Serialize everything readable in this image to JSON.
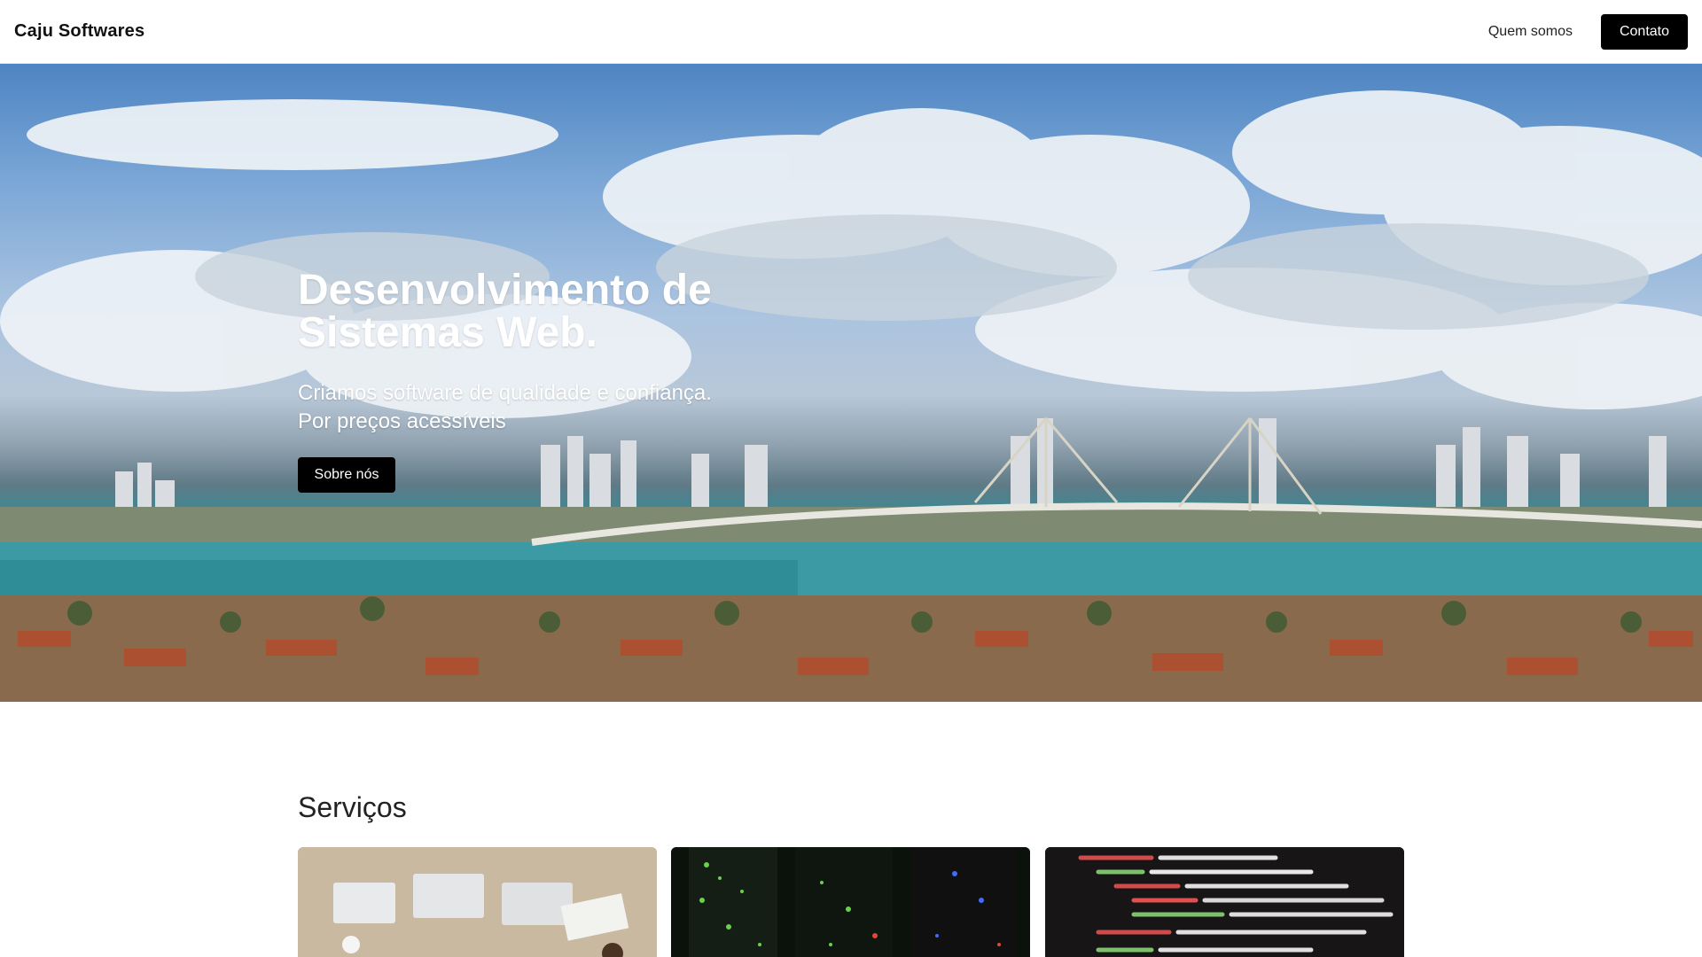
{
  "header": {
    "brand": "Caju Softwares",
    "nav_quem_somos": "Quem somos",
    "nav_contato": "Contato"
  },
  "hero": {
    "title_line1": "Desenvolvimento de",
    "title_line2": "Sistemas Web.",
    "subtitle_line1": "Criamos software de qualidade e confiança.",
    "subtitle_line2": "Por preços acessíveis",
    "button_label": "Sobre nós"
  },
  "services": {
    "title": "Serviços",
    "cards": [
      {
        "icon": "team-laptops-image"
      },
      {
        "icon": "server-rack-image"
      },
      {
        "icon": "code-screen-image"
      }
    ]
  },
  "colors": {
    "button_bg": "#000000",
    "button_text": "#ffffff",
    "header_bg": "#ffffff"
  }
}
